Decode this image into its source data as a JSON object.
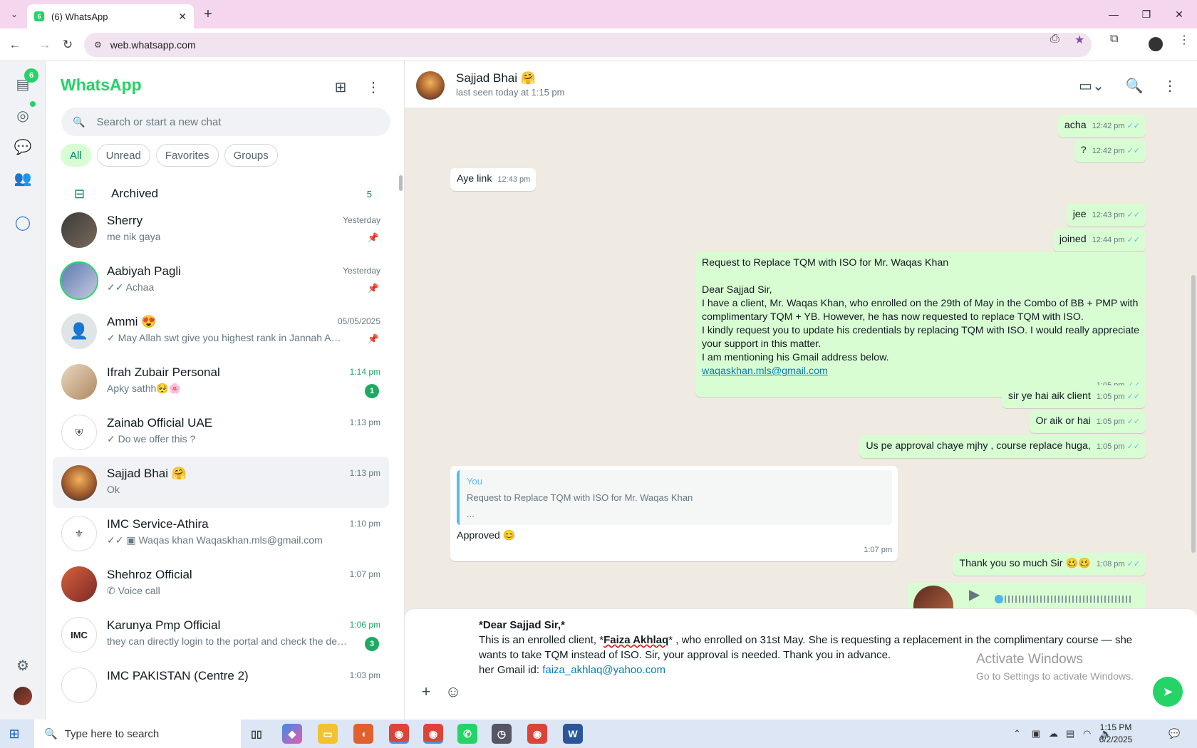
{
  "browser": {
    "tab_title": "(6) WhatsApp",
    "url": "web.whatsapp.com",
    "window_controls": [
      "minimize",
      "maximize",
      "close"
    ]
  },
  "rail": {
    "chats_badge": "6",
    "items": [
      "chats-icon",
      "status-icon",
      "channels-icon",
      "communities-icon",
      "meta-ai-icon",
      "settings-icon"
    ]
  },
  "sidebar": {
    "brand": "WhatsApp",
    "search_placeholder": "Search or start a new chat",
    "filters": [
      "All",
      "Unread",
      "Favorites",
      "Groups"
    ],
    "archived": {
      "label": "Archived",
      "count": "5"
    },
    "chats": [
      {
        "name": "Sherry",
        "time": "Yesterday",
        "preview": "me nik gaya",
        "pinned": true
      },
      {
        "name": "Aabiyah Pagli",
        "time": "Yesterday",
        "preview": "✓✓ Achaa",
        "pinned": true
      },
      {
        "name": "Ammi 😍",
        "time": "05/05/2025",
        "preview": "✓ May Allah swt give you highest rank in Jannah  Ame...",
        "pinned": true
      },
      {
        "name": "Ifrah Zubair Personal",
        "time": "1:14 pm",
        "preview": "Apky sathh🥺🌸",
        "unread": "1"
      },
      {
        "name": "Zainab Official UAE",
        "time": "1:13 pm",
        "preview": "✓ Do we offer this ?"
      },
      {
        "name": "Sajjad Bhai 🤗",
        "time": "1:13 pm",
        "preview": "Ok"
      },
      {
        "name": "IMC Service-Athira",
        "time": "1:10 pm",
        "preview": "✓✓ ▣ Waqas khan  Waqaskhan.mls@gmail.com"
      },
      {
        "name": "Shehroz Official",
        "time": "1:07 pm",
        "preview": "✆ Voice call"
      },
      {
        "name": "Karunya Pmp Official",
        "time": "1:06 pm",
        "preview": "they can directly login to the portal and check the details",
        "unread": "3"
      },
      {
        "name": "IMC PAKISTAN (Centre 2)",
        "time": "1:03 pm",
        "preview": ""
      }
    ]
  },
  "conversation": {
    "name": "Sajjad Bhai 🤗",
    "status": "last seen today at 1:15 pm",
    "messages": [
      {
        "text": "acha",
        "time": "12:42 pm"
      },
      {
        "text": "?",
        "time": "12:42 pm"
      },
      {
        "text": "Aye link",
        "time": "12:43 pm"
      },
      {
        "text": "jee",
        "time": "12:43 pm"
      },
      {
        "text": "joined",
        "time": "12:44 pm"
      },
      {
        "lines": [
          "Request to Replace TQM with ISO for Mr. Waqas Khan",
          "",
          "Dear Sajjad Sir,",
          "I have a client, Mr. Waqas Khan, who enrolled on the 29th of May in the Combo of BB + PMP with complimentary TQM + YB. However, he has now requested to replace TQM with ISO.",
          "I kindly request you to update his credentials by replacing TQM with ISO. I would really appreciate your support in this matter.",
          "I am mentioning his Gmail address below."
        ],
        "link": "waqaskhan.mls@gmail.com",
        "time": "1:05 pm"
      },
      {
        "text": "sir ye hai aik client",
        "time": "1:05 pm"
      },
      {
        "text": "Or aik or hai",
        "time": "1:05 pm"
      },
      {
        "text": "Us pe approval chaye mjhy , course replace huga,",
        "time": "1:05 pm"
      },
      {
        "quote_author": "You",
        "quote_text": "Request to Replace TQM with ISO for Mr. Waqas Khan",
        "quote_more": "...",
        "text": "Approved 😊",
        "time": "1:07 pm"
      },
      {
        "text": "Thank you so much Sir 🥴🥴",
        "time": "1:08 pm"
      }
    ]
  },
  "composer": {
    "line1": "*Dear Sajjad Sir,*",
    "line2_a": "This is an enrolled client, *",
    "line2_b": "Faiza Akhlaq",
    "line2_c": "* , who enrolled on 31st May. She is requesting a replacement in the complimentary course — she",
    "line3": "wants to take TQM instead of ISO. Sir, your approval is needed. Thank you in advance.",
    "line4_label": "her Gmail id: ",
    "line4_mail": "faiza_akhlaq@yahoo.com"
  },
  "watermark": {
    "title": "Activate Windows",
    "subtitle": "Go to Settings to activate Windows."
  },
  "taskbar": {
    "search_placeholder": "Type here to search",
    "time": "1:15 PM",
    "date": "6/2/2025"
  },
  "colors": {
    "brand_green": "#25d366",
    "outgoing_bubble": "#d9fdd3",
    "chat_bg": "#efeae2",
    "tab_bar": "#f4d7ee"
  }
}
